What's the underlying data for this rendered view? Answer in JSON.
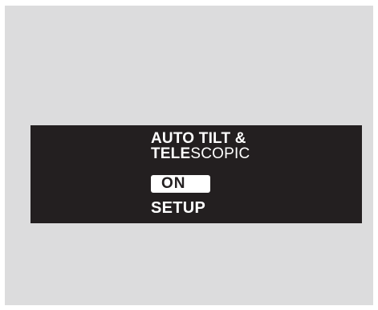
{
  "screen": {
    "title_line1_a": "AUTO",
    "title_line1_b": " TILT &",
    "title_line2_a": "TELE",
    "title_line2_b": "SCOPIC",
    "options": [
      {
        "label": "ON",
        "selected": true
      },
      {
        "label": "SETUP",
        "selected": false
      }
    ]
  },
  "colors": {
    "background": "#dcdcdd",
    "display": "#231f20",
    "text": "#ffffff",
    "highlight": "#ffffff"
  }
}
